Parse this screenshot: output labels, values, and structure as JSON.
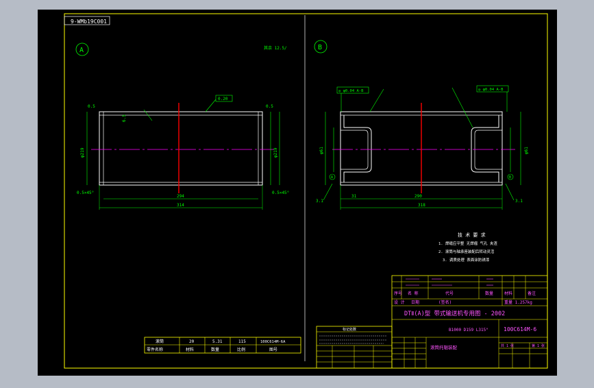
{
  "drawing_number_mirrored": "9-WMb19C001",
  "view_a": {
    "label": "A",
    "roughness_note": "其余 12.5/",
    "flatness_box": "0.20",
    "edge_label_left": "0.5",
    "edge_label_right": "0.5",
    "chamfer_left": "0.5×45°",
    "chamfer_right": "0.5×45°",
    "dim_inner": "294",
    "dim_outer": "314",
    "dia_left": "φ219",
    "dia_right": "φ219",
    "wall_note": "6.5"
  },
  "view_b": {
    "label": "B",
    "tol_box_left": "◎ φ0.04 A-B",
    "tol_box_right": "◎ φ0.04 A-B",
    "datum_left": "A",
    "datum_right": "B",
    "dim_flange": "31",
    "dim_inner": "290",
    "dim_outer": "318",
    "dia_left": "φ61",
    "dia_right": "φ61",
    "side_mark_left": "3.1",
    "side_mark_right": "3.1"
  },
  "tech_requirements": {
    "title": "技 术 要 求",
    "lines": [
      "1. 焊缝应平整 无焊瘤 气孔 夹渣",
      "2. 滚筒与轴承座装配后转动灵活",
      "3. 调质处理 表面涂防锈漆"
    ]
  },
  "small_table": {
    "row1": [
      "滚筒",
      "20",
      "5.31",
      "115",
      "100C614M-6A"
    ],
    "row2": [
      "零件名称",
      "材料",
      "数量",
      "比例",
      "图号"
    ]
  },
  "title_block": {
    "header_row1": [
      "",
      "",
      "",
      "",
      ""
    ],
    "mid_row": [
      "序号",
      "名 称",
      "代号",
      "数量",
      "材料",
      "备注"
    ],
    "weight_row": [
      "设 计",
      "日期",
      "(签名)",
      "重量 1.257kg"
    ],
    "project_title": "DTⅡ(A)型 带式输送机专用图 - 2002",
    "spec": "B1000  D159  L315°",
    "drawing_code": "100C614M-6",
    "part_name": "滚筒托辊装配",
    "change_table_title": "标记处数",
    "sheet_marks": [
      "共 1 张",
      "第 1 张"
    ]
  },
  "colors": {
    "frame": "#ffff00",
    "border": "#ffffff",
    "part": "#ffffff",
    "dimension": "#00ff00",
    "center": "#ff00ff",
    "red": "#ff0000",
    "text_magenta": "#ff55ff"
  }
}
